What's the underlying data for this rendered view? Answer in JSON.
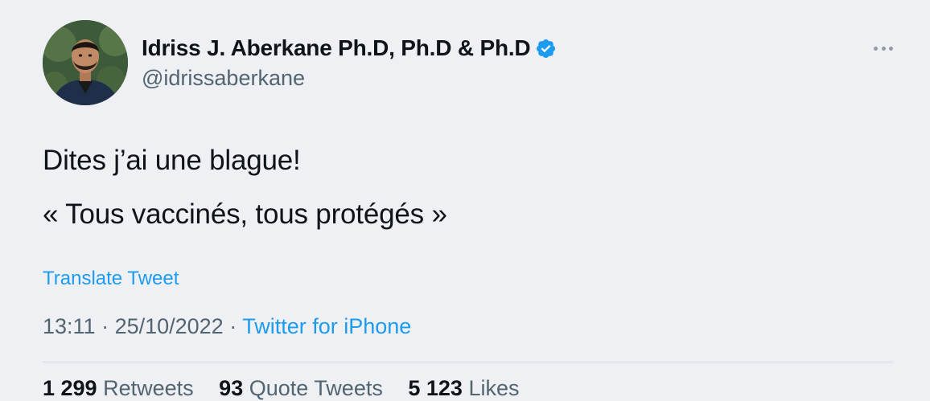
{
  "tweet": {
    "author": {
      "display_name": "Idriss J. Aberkane Ph.D, Ph.D & Ph.D",
      "handle": "@idrissaberkane",
      "verified": true,
      "avatar_icon": "profile-photo"
    },
    "more_icon": "more-horizontal-icon",
    "text_lines": [
      "Dites j’ai une blague!",
      "« Tous vaccinés, tous protégés »"
    ],
    "translate_label": "Translate Tweet",
    "time": "13:11",
    "date": "25/10/2022",
    "separator": " · ",
    "source": "Twitter for iPhone",
    "stats": [
      {
        "count": "1 299",
        "label": "Retweets"
      },
      {
        "count": "93",
        "label": "Quote Tweets"
      },
      {
        "count": "5 123",
        "label": "Likes"
      }
    ]
  },
  "colors": {
    "background": "#eef0f3",
    "text": "#0f1419",
    "secondary": "#536471",
    "link": "#1d9bf0",
    "verified_badge": "#1d9bf0"
  }
}
